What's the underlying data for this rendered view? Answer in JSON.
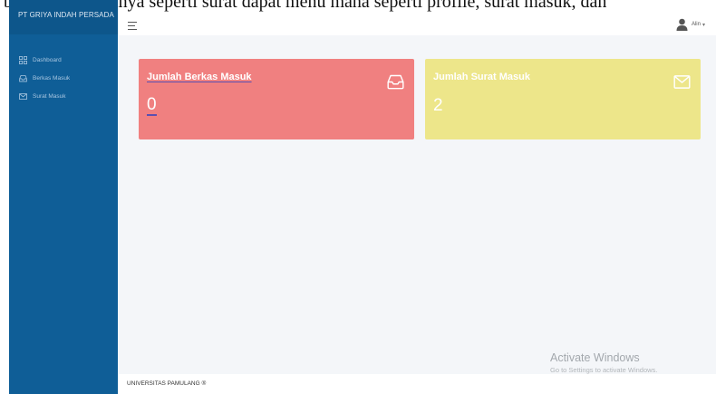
{
  "top_strip": {
    "text": "bekas mutu lainnya seperti surat dapat menu mana seperti profile, surat masuk, dan"
  },
  "brand": {
    "name": "PT GRIYA INDAH PERSADA"
  },
  "sidebar": {
    "items": [
      {
        "label": "Dashboard",
        "icon": "dashboard-icon"
      },
      {
        "label": "Berkas Masuk",
        "icon": "inbox-icon"
      },
      {
        "label": "Surat Masuk",
        "icon": "mail-icon"
      }
    ]
  },
  "header": {
    "menu_icon": "hamburger-icon",
    "user": {
      "name": "Alin",
      "icon": "user-icon"
    }
  },
  "cards": [
    {
      "title": "Jumlah Berkas Masuk",
      "value": "0",
      "icon": "inbox-icon",
      "color": "#f08080"
    },
    {
      "title": "Jumlah Surat Masuk",
      "value": "2",
      "icon": "mail-icon",
      "color": "#ede68a"
    }
  ],
  "footer": {
    "text": "UNIVERSITAS PAMULANG ®"
  },
  "watermark": {
    "line1": "Activate Windows",
    "line2": "Go to Settings to activate Windows."
  },
  "colors": {
    "sidebar": "#0f5e97",
    "brand": "#0d568b",
    "background": "#f4f6f9"
  }
}
